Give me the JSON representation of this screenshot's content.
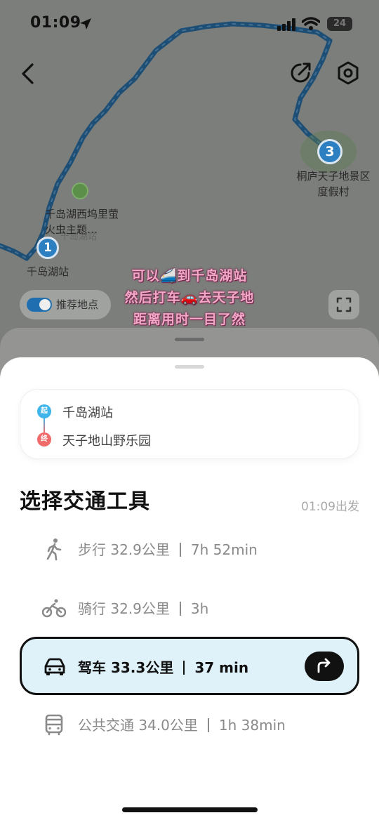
{
  "status_bar": {
    "time": "01:09",
    "battery": "24"
  },
  "map": {
    "poi_label": "千岛湖西坞里萤火虫主题…",
    "station_ghost_label": "千岛湖站",
    "station_label": "千岛湖站",
    "pin_start": "1",
    "pin_end": "3",
    "resort_label": "桐庐天子地景区度假村",
    "recommend_toggle_label": "推荐地点",
    "route_color": "#2f7fbd"
  },
  "caption": {
    "line1": "可以🚄到千岛湖站",
    "line2": "然后打车🚗去天子地",
    "line3": "距离用时一目了然"
  },
  "route_card": {
    "start_badge": "起",
    "start_place": "千岛湖站",
    "end_badge": "终",
    "end_place": "天子地山野乐园"
  },
  "transport": {
    "title": "选择交通工具",
    "depart_time": "01:09出发",
    "modes": [
      {
        "icon": "walk-icon",
        "name": "步行",
        "distance": "32.9公里",
        "duration": "7h 52min"
      },
      {
        "icon": "bike-icon",
        "name": "骑行",
        "distance": "32.9公里",
        "duration": "3h"
      },
      {
        "icon": "car-icon",
        "name": "驾车",
        "distance": "33.3公里",
        "duration": "37 min",
        "selected": true
      },
      {
        "icon": "bus-icon",
        "name": "公共交通",
        "distance": "34.0公里",
        "duration": "1h 38min"
      }
    ]
  },
  "colors": {
    "accent": "#dff2f9",
    "start": "#3fb4ea",
    "end": "#f06a6a",
    "caption": "#f2a8c7"
  }
}
